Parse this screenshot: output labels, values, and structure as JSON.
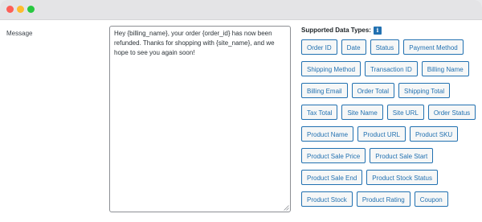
{
  "message": {
    "label": "Message",
    "value": "Hey {billing_name}, your order {order_id} has now been refunded. Thanks for shopping with {site_name}, and we hope to see you again soon!"
  },
  "data_types": {
    "title": "Supported Data Types:",
    "info_icon": "i",
    "tags": [
      "Order ID",
      "Date",
      "Status",
      "Payment Method",
      "Shipping Method",
      "Transaction ID",
      "Billing Name",
      "Billing Email",
      "Order Total",
      "Shipping Total",
      "Tax Total",
      "Site Name",
      "Site URL",
      "Order Status",
      "Product Name",
      "Product URL",
      "Product SKU",
      "Product Sale Price",
      "Product Sale Start",
      "Product Sale End",
      "Product Stock Status",
      "Product Stock",
      "Product Rating",
      "Coupon"
    ]
  },
  "colors": {
    "accent": "#2271b1",
    "window_close": "#fd5f57",
    "window_minimize": "#febc2e",
    "window_maximize": "#28c840"
  }
}
